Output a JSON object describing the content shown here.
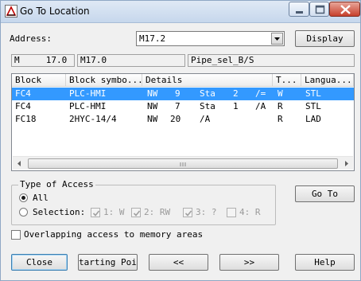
{
  "window": {
    "title": "Go To Location",
    "app_icon": "angle-tool-icon",
    "controls": {
      "minimize": "minimize-icon",
      "maximize": "maximize-icon",
      "close": "close-icon"
    }
  },
  "address": {
    "label": "Address:",
    "value": "M17.2",
    "display_button": "Display"
  },
  "info": {
    "operand": "M     17.0",
    "symbolic": "M17.0",
    "symbol": "Pipe_sel_B/S"
  },
  "table": {
    "columns": [
      "Block",
      "Block symbo...",
      "Details",
      "T...",
      "Langua..."
    ],
    "rows": [
      {
        "block": "FC4",
        "symbol": "PLC-HMI",
        "d1": "NW",
        "d2": "9",
        "d3": "Sta",
        "d4": "2",
        "d5": "/=",
        "type": "W",
        "lang": "STL",
        "selected": true
      },
      {
        "block": "FC4",
        "symbol": "PLC-HMI",
        "d1": "NW",
        "d2": "7",
        "d3": "Sta",
        "d4": "1",
        "d5": "/A",
        "type": "R",
        "lang": "STL",
        "selected": false
      },
      {
        "block": "FC18",
        "symbol": "2HYC-14/4",
        "d1": "NW",
        "d2": "20",
        "d3": "/A",
        "d4": "",
        "d5": "",
        "type": "R",
        "lang": "LAD",
        "selected": false
      }
    ]
  },
  "access": {
    "group_title": "Type of Access",
    "all_label": "All",
    "selection_label": "Selection:",
    "selected": "All",
    "options": [
      {
        "label": "1: W",
        "checked": true
      },
      {
        "label": "2: RW",
        "checked": true
      },
      {
        "label": "3: ?",
        "checked": true
      },
      {
        "label": "4: R",
        "checked": false
      }
    ]
  },
  "goto_button": "Go To",
  "overlap": {
    "label": "Overlapping access to memory areas",
    "checked": false
  },
  "buttons": {
    "close": "Close",
    "starting_point": "tarting Poin",
    "previous": "<<",
    "next": ">>",
    "help": "Help"
  },
  "colors": {
    "selection": "#3399ff",
    "window_bg": "#f0f0f0",
    "titlebar": "#c6d7ec",
    "close_button": "#c7402c"
  }
}
